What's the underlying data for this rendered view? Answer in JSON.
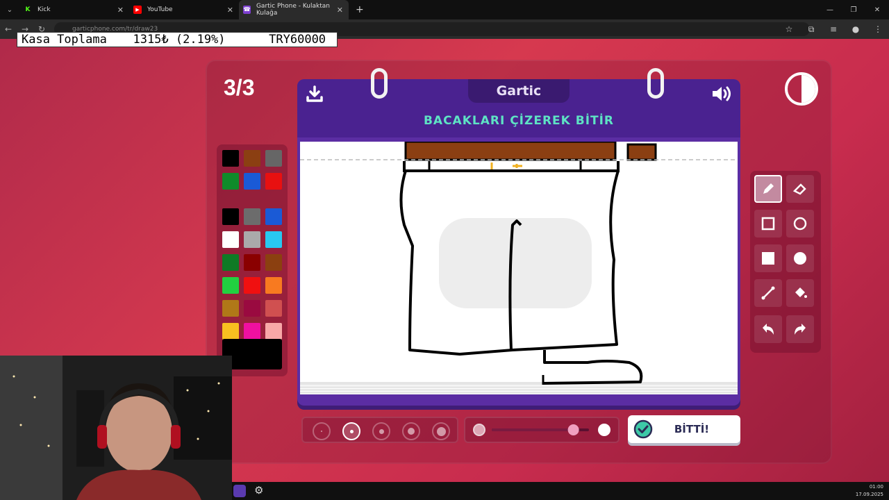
{
  "browser": {
    "tabs": [
      {
        "title": "Kick",
        "favicon": "kick-icon",
        "color": "#53fc18"
      },
      {
        "title": "YouTube",
        "favicon": "youtube-icon",
        "color": "#ff0000"
      },
      {
        "title": "Gartic Phone - Kulaktan Kulağa",
        "favicon": "gartic-icon",
        "color": "#7d3fd0"
      }
    ],
    "url": "garticphone.com/tr/draw23"
  },
  "ticker": {
    "label": "Kasa Toplama",
    "amount": "1315₺ (2.19%)",
    "goal": "TRY60000"
  },
  "game": {
    "round": "3/3",
    "logo": "Gartic",
    "instruction": "BACAKLARI ÇİZEREK BİTİR",
    "done_label": "BİTTİ!",
    "colors": {
      "background": "#d6394f",
      "board": "#5b2da3",
      "instruction": "#5ee3c4"
    },
    "palette": [
      "#000000",
      "#8b3f12",
      "#666666",
      "#0f8b2a",
      "#1a5ad6",
      "#e81010",
      "#000000",
      "#6c6c6c",
      "#1a5ad6",
      "#ffffff",
      "#aaaaaa",
      "#28c8f0",
      "#0f7a25",
      "#8a0000",
      "#8b4010",
      "#22d040",
      "#f01010",
      "#f87a20",
      "#b07818",
      "#9a0a40",
      "#d05050",
      "#f8c020",
      "#f010a0",
      "#f8a8a8"
    ],
    "selected_color": "#000000",
    "tools": [
      "pencil-icon",
      "eraser-icon",
      "square-outline-icon",
      "circle-outline-icon",
      "square-fill-icon",
      "circle-fill-icon",
      "line-icon",
      "fill-bucket-icon",
      "undo-icon",
      "redo-icon"
    ],
    "selected_tool": "pencil-icon",
    "brush_sizes": 5,
    "selected_size_index": 1,
    "opacity_level": 0.85
  },
  "system": {
    "time": "01:00",
    "date": "17.09.2025"
  }
}
